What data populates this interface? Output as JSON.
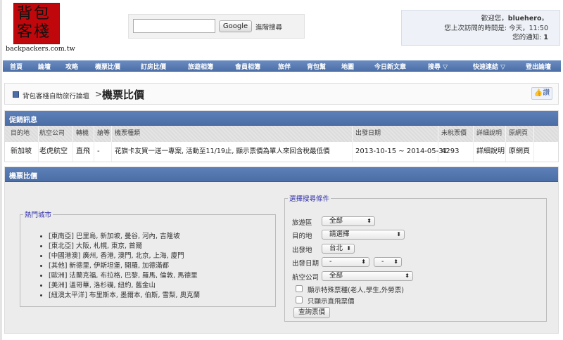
{
  "logo": {
    "chars": "背包客棧",
    "site": "backpackers.com.tw"
  },
  "search": {
    "value": "",
    "button": "Google",
    "advanced": "進階搜尋"
  },
  "user": {
    "welcome": "歡迎您，",
    "name": "bluehero",
    "suffix": "。",
    "last_visit_label": "您上次訪問的時間是:",
    "last_visit": "今天，11:50",
    "notify_label": "您的通知:",
    "notify_count": "1"
  },
  "nav": [
    "首頁",
    "論壇",
    "攻略",
    "機票比價",
    "訂房比價",
    "旅遊相簿",
    "會員相簿",
    "旅伴",
    "背包幫",
    "地圖",
    "今日新文章",
    "搜尋 ▽",
    "快速連結 ▽",
    "登出論壇"
  ],
  "breadcrumb": {
    "parent": "背包客棧自助旅行論壇",
    "sep": ">",
    "current": "機票比價",
    "like": "讚"
  },
  "promo": {
    "title": "促銷訊息",
    "headers": [
      "目的地",
      "航空公司",
      "轉機",
      "艙等",
      "機票種類",
      "出發日期",
      "未稅票價",
      "詳細說明",
      "原網頁"
    ],
    "rows": [
      [
        "新加坡",
        "老虎航空",
        "直飛",
        "-",
        "花旗卡友買一送一專案, 活動至11/19止, 顯示票價為單人來回含稅最低價",
        "2013-10-15 ~ 2014-05-31",
        "4293",
        "詳細說明",
        "原網頁"
      ]
    ]
  },
  "price": {
    "title": "機票比價",
    "hot": {
      "legend": "熱門城市",
      "items": [
        "[東南亞] 巴里島, 新加坡, 曼谷, 河內, 吉隆坡",
        "[東北亞] 大阪, 札幌, 東京, 首爾",
        "[中國港澳] 廣州, 香港, 澳門, 北京, 上海, 廈門",
        "[其他] 新德里, 伊斯坦堡, 開羅, 加德滿都",
        "[歐洲] 法蘭克福, 布拉格, 巴黎, 羅馬, 倫敦, 馬德里",
        "[美洲] 溫哥華, 洛杉磯, 紐約, 舊金山",
        "[紐澳太平洋] 布里斯本, 墨爾本, 伯斯, 雪梨, 奧克蘭"
      ]
    },
    "criteria": {
      "legend": "選擇搜尋條件",
      "region_label": "旅遊區",
      "region": "全部",
      "dest_label": "目的地",
      "dest": "請選擇",
      "from_label": "出發地",
      "from": "台北",
      "date_label": "出發日期",
      "date1": "-",
      "date2": "-",
      "airline_label": "航空公司",
      "airline": "全部",
      "special": "顯示特殊票種(老人,學生,外勞票)",
      "direct": "只顯示直飛票價",
      "submit": "查詢票價"
    }
  }
}
